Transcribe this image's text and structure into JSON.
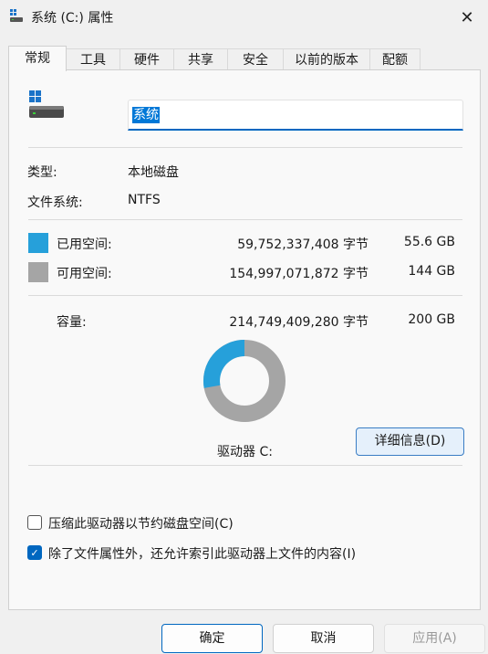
{
  "window": {
    "title": "系统 (C:) 属性",
    "close_glyph": "✕"
  },
  "tabs": [
    {
      "label": "常规",
      "active": true
    },
    {
      "label": "工具"
    },
    {
      "label": "硬件"
    },
    {
      "label": "共享"
    },
    {
      "label": "安全"
    },
    {
      "label": "以前的版本"
    },
    {
      "label": "配额"
    }
  ],
  "drive": {
    "name_value": "系统",
    "type_label": "类型:",
    "type_value": "本地磁盘",
    "fs_label": "文件系统:",
    "fs_value": "NTFS"
  },
  "space": {
    "used": {
      "label": "已用空间:",
      "bytes": "59,752,337,408 字节",
      "size": "55.6 GB",
      "color": "#26a0da"
    },
    "free": {
      "label": "可用空间:",
      "bytes": "154,997,071,872 字节",
      "size": "144 GB",
      "color": "#a5a5a5"
    },
    "capacity": {
      "label": "容量:",
      "bytes": "214,749,409,280 字节",
      "size": "200 GB"
    },
    "used_fraction": 0.278
  },
  "drive_label": "驱动器 C:",
  "details_button": "详细信息(D)",
  "options": {
    "compress": {
      "label": "压缩此驱动器以节约磁盘空间(C)",
      "checked": false
    },
    "index": {
      "label": "除了文件属性外，还允许索引此驱动器上文件的内容(I)",
      "checked": true
    }
  },
  "buttons": {
    "ok": "确定",
    "cancel": "取消",
    "apply": "应用(A)"
  }
}
